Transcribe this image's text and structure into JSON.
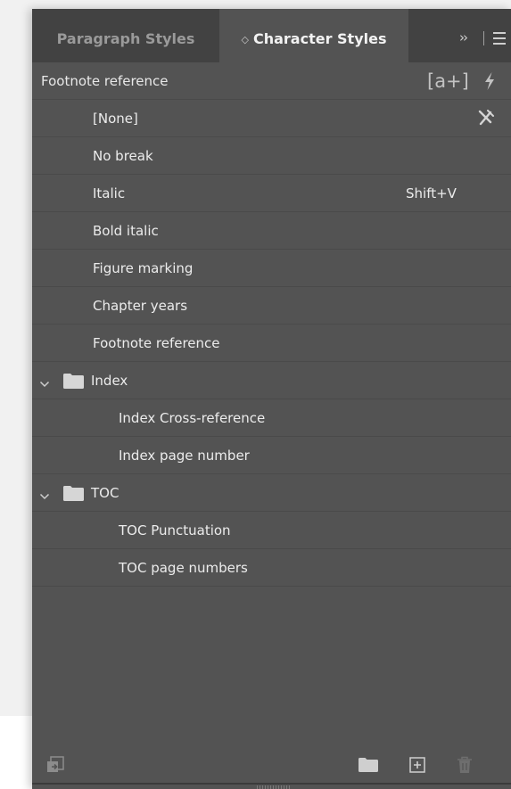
{
  "tabs": {
    "paragraph_styles": "Paragraph Styles",
    "character_styles": "Character Styles",
    "stepper_glyph": "◇",
    "collapse_glyph": "››"
  },
  "header": {
    "title": "Footnote reference",
    "new_override_icon": "[a+]",
    "quick_apply_icon": "lightning-icon"
  },
  "styles": [
    {
      "label": "[None]",
      "level": 1,
      "icon": "clear-overrides-icon"
    },
    {
      "label": "No break",
      "level": 1
    },
    {
      "label": "Italic",
      "level": 1,
      "shortcut": "Shift+V"
    },
    {
      "label": "Bold italic",
      "level": 1
    },
    {
      "label": "Figure marking",
      "level": 1
    },
    {
      "label": "Chapter years",
      "level": 1
    },
    {
      "label": "Footnote reference",
      "level": 1
    },
    {
      "label": "Index",
      "level": 0,
      "group": true,
      "expanded": true
    },
    {
      "label": "Index Cross-reference",
      "level": 2
    },
    {
      "label": "Index page number",
      "level": 2
    },
    {
      "label": "TOC",
      "level": 0,
      "group": true,
      "expanded": true
    },
    {
      "label": "TOC Punctuation",
      "level": 2
    },
    {
      "label": "TOC page numbers",
      "level": 2
    }
  ],
  "footer": {
    "icons": [
      "load-styles-icon",
      "new-group-folder-icon",
      "new-style-icon",
      "delete-icon"
    ]
  },
  "colors": {
    "panel_bg": "#535353",
    "tab_bar_bg": "#424242",
    "text": "#ececec",
    "muted_icon": "#8c8c8c"
  }
}
